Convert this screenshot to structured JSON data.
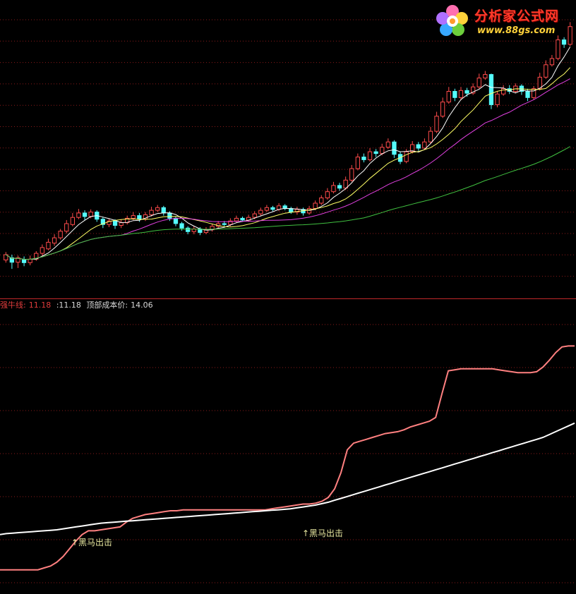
{
  "logo": {
    "title": "分析家公式网",
    "url": "www.88gs.com"
  },
  "header": {
    "indicator_label": "强牛线:",
    "indicator_value": "11.18",
    "second_value": ":11.18",
    "top_cost_label": "顶部成本价:",
    "top_cost_value": "14.06"
  },
  "signals": [
    {
      "label": "↑黑马出击"
    },
    {
      "label": "↑黑马出击"
    }
  ],
  "colors": {
    "up": "#ff4b4b",
    "down": "#54fcfc",
    "ma_short": "#ffffff",
    "ma_mid": "#ffff66",
    "ma_long": "#e040e0",
    "ma_longest": "#40c040",
    "cost_line": "#ff8080",
    "base_line": "#ffffff",
    "grid": "#8a1a1a"
  },
  "chart_data": [
    {
      "type": "candlestick",
      "title": "",
      "ylim": [
        9.4,
        15.6
      ],
      "candles": [
        [
          9.9,
          10.02,
          10.08,
          9.84
        ],
        [
          9.95,
          9.85,
          10.02,
          9.7
        ],
        [
          9.85,
          9.95,
          10.0,
          9.72
        ],
        [
          9.9,
          9.84,
          9.98,
          9.76
        ],
        [
          9.84,
          9.92,
          10.0,
          9.78
        ],
        [
          9.92,
          10.05,
          10.1,
          9.88
        ],
        [
          10.05,
          10.18,
          10.25,
          10.0
        ],
        [
          10.15,
          10.3,
          10.38,
          10.12
        ],
        [
          10.28,
          10.4,
          10.48,
          10.22
        ],
        [
          10.4,
          10.55,
          10.6,
          10.36
        ],
        [
          10.55,
          10.72,
          10.8,
          10.5
        ],
        [
          10.7,
          10.86,
          10.96,
          10.66
        ],
        [
          10.86,
          10.96,
          11.05,
          10.82
        ],
        [
          10.96,
          10.88,
          11.02,
          10.8
        ],
        [
          10.88,
          10.98,
          11.04,
          10.84
        ],
        [
          10.98,
          10.82,
          11.02,
          10.76
        ],
        [
          10.82,
          10.7,
          10.86,
          10.62
        ],
        [
          10.7,
          10.78,
          10.84,
          10.64
        ],
        [
          10.78,
          10.68,
          10.82,
          10.6
        ],
        [
          10.68,
          10.74,
          10.82,
          10.62
        ],
        [
          10.74,
          10.84,
          10.9,
          10.7
        ],
        [
          10.84,
          10.9,
          10.98,
          10.8
        ],
        [
          10.9,
          10.82,
          10.96,
          10.76
        ],
        [
          10.82,
          10.92,
          10.98,
          10.78
        ],
        [
          10.92,
          11.02,
          11.1,
          10.88
        ],
        [
          11.02,
          11.08,
          11.14,
          10.98
        ],
        [
          11.08,
          10.96,
          11.12,
          10.9
        ],
        [
          10.96,
          10.84,
          11.0,
          10.78
        ],
        [
          10.84,
          10.72,
          10.88,
          10.66
        ],
        [
          10.72,
          10.62,
          10.76,
          10.56
        ],
        [
          10.62,
          10.54,
          10.66,
          10.48
        ],
        [
          10.54,
          10.6,
          10.66,
          10.48
        ],
        [
          10.6,
          10.52,
          10.64,
          10.46
        ],
        [
          10.52,
          10.58,
          10.64,
          10.48
        ],
        [
          10.58,
          10.66,
          10.72,
          10.54
        ],
        [
          10.66,
          10.72,
          10.78,
          10.62
        ],
        [
          10.72,
          10.7,
          10.78,
          10.66
        ],
        [
          10.7,
          10.78,
          10.84,
          10.66
        ],
        [
          10.78,
          10.84,
          10.9,
          10.74
        ],
        [
          10.84,
          10.8,
          10.88,
          10.76
        ],
        [
          10.8,
          10.86,
          10.92,
          10.76
        ],
        [
          10.86,
          10.94,
          11.0,
          10.82
        ],
        [
          10.94,
          11.02,
          11.08,
          10.9
        ],
        [
          11.02,
          11.08,
          11.14,
          10.98
        ],
        [
          11.08,
          11.04,
          11.12,
          11.0
        ],
        [
          11.04,
          11.12,
          11.18,
          11.0
        ],
        [
          11.12,
          11.06,
          11.16,
          11.02
        ],
        [
          11.06,
          10.98,
          11.1,
          10.94
        ],
        [
          10.98,
          11.04,
          11.1,
          10.92
        ],
        [
          11.04,
          10.96,
          11.08,
          10.9
        ],
        [
          10.96,
          11.06,
          11.12,
          10.92
        ],
        [
          11.06,
          11.18,
          11.24,
          11.02
        ],
        [
          11.18,
          11.3,
          11.36,
          11.14
        ],
        [
          11.3,
          11.44,
          11.52,
          11.26
        ],
        [
          11.44,
          11.58,
          11.66,
          11.4
        ],
        [
          11.58,
          11.52,
          11.64,
          11.46
        ],
        [
          11.52,
          11.7,
          11.78,
          11.48
        ],
        [
          11.7,
          11.96,
          12.04,
          11.66
        ],
        [
          11.96,
          12.22,
          12.3,
          11.92
        ],
        [
          12.22,
          12.16,
          12.3,
          12.1
        ],
        [
          12.16,
          12.34,
          12.42,
          12.12
        ],
        [
          12.34,
          12.3,
          12.4,
          12.22
        ],
        [
          12.3,
          12.44,
          12.52,
          12.26
        ],
        [
          12.44,
          12.56,
          12.64,
          12.4
        ],
        [
          12.56,
          12.28,
          12.6,
          12.2
        ],
        [
          12.28,
          12.12,
          12.34,
          12.06
        ],
        [
          12.12,
          12.34,
          12.4,
          12.08
        ],
        [
          12.34,
          12.5,
          12.58,
          12.3
        ],
        [
          12.5,
          12.42,
          12.56,
          12.36
        ],
        [
          12.42,
          12.56,
          12.64,
          12.38
        ],
        [
          12.56,
          12.8,
          12.9,
          12.52
        ],
        [
          12.8,
          13.14,
          13.24,
          12.76
        ],
        [
          13.14,
          13.46,
          13.56,
          13.1
        ],
        [
          13.46,
          13.7,
          13.8,
          13.42
        ],
        [
          13.7,
          13.56,
          13.76,
          13.48
        ],
        [
          13.56,
          13.72,
          13.8,
          13.5
        ],
        [
          13.72,
          13.66,
          13.78,
          13.58
        ],
        [
          13.66,
          13.8,
          13.88,
          13.62
        ],
        [
          13.8,
          14.0,
          14.1,
          13.76
        ],
        [
          14.0,
          14.08,
          14.16,
          13.96
        ],
        [
          14.08,
          13.4,
          14.1,
          13.3
        ],
        [
          13.4,
          13.64,
          13.7,
          13.34
        ],
        [
          13.64,
          13.76,
          13.84,
          13.6
        ],
        [
          13.76,
          13.7,
          13.84,
          13.64
        ],
        [
          13.7,
          13.82,
          13.88,
          13.66
        ],
        [
          13.82,
          13.7,
          13.86,
          13.62
        ],
        [
          13.7,
          13.56,
          13.76,
          13.48
        ],
        [
          13.56,
          13.76,
          13.82,
          13.52
        ],
        [
          13.76,
          14.02,
          14.12,
          13.72
        ],
        [
          14.02,
          14.3,
          14.4,
          13.98
        ],
        [
          14.3,
          14.44,
          14.52,
          14.26
        ],
        [
          14.44,
          14.86,
          14.96,
          14.4
        ],
        [
          14.86,
          14.76,
          14.92,
          14.68
        ],
        [
          14.76,
          15.16,
          15.26,
          14.72
        ]
      ],
      "series": [
        {
          "name": "",
          "type": "ma",
          "period": 5
        },
        {
          "name": "",
          "type": "ma",
          "period": 10
        },
        {
          "name": "",
          "type": "ma",
          "period": 20
        },
        {
          "name": "",
          "type": "ma",
          "period": 60
        }
      ],
      "grid": true
    },
    {
      "type": "line",
      "title": "",
      "ylim": [
        9.0,
        14.6
      ],
      "series": [
        {
          "name": "强牛线",
          "values": [
            9.36,
            9.36,
            9.36,
            9.36,
            9.36,
            9.36,
            9.36,
            9.4,
            9.44,
            9.52,
            9.64,
            9.8,
            9.96,
            10.1,
            10.18,
            10.18,
            10.2,
            10.22,
            10.24,
            10.26,
            10.36,
            10.44,
            10.48,
            10.52,
            10.54,
            10.56,
            10.58,
            10.6,
            10.6,
            10.62,
            10.62,
            10.62,
            10.62,
            10.62,
            10.62,
            10.62,
            10.62,
            10.62,
            10.62,
            10.62,
            10.62,
            10.62,
            10.62,
            10.64,
            10.66,
            10.68,
            10.7,
            10.72,
            10.74,
            10.74,
            10.76,
            10.8,
            10.88,
            11.06,
            11.4,
            11.88,
            12.02,
            12.06,
            12.1,
            12.14,
            12.18,
            12.22,
            12.24,
            12.26,
            12.3,
            12.36,
            12.4,
            12.44,
            12.48,
            12.56,
            13.06,
            13.54,
            13.56,
            13.58,
            13.58,
            13.58,
            13.58,
            13.58,
            13.58,
            13.56,
            13.54,
            13.52,
            13.5,
            13.5,
            13.5,
            13.52,
            13.62,
            13.76,
            13.92,
            14.04,
            14.06,
            14.06
          ]
        },
        {
          "name": "",
          "values": [
            10.1,
            10.12,
            10.13,
            10.14,
            10.15,
            10.16,
            10.17,
            10.18,
            10.19,
            10.2,
            10.22,
            10.24,
            10.26,
            10.28,
            10.3,
            10.32,
            10.34,
            10.35,
            10.36,
            10.37,
            10.38,
            10.39,
            10.4,
            10.41,
            10.42,
            10.43,
            10.44,
            10.45,
            10.46,
            10.47,
            10.48,
            10.49,
            10.5,
            10.51,
            10.52,
            10.53,
            10.54,
            10.55,
            10.56,
            10.57,
            10.58,
            10.59,
            10.6,
            10.61,
            10.62,
            10.63,
            10.64,
            10.66,
            10.68,
            10.7,
            10.72,
            10.75,
            10.78,
            10.82,
            10.86,
            10.9,
            10.94,
            10.98,
            11.02,
            11.06,
            11.1,
            11.14,
            11.18,
            11.22,
            11.26,
            11.3,
            11.34,
            11.38,
            11.42,
            11.46,
            11.5,
            11.54,
            11.58,
            11.62,
            11.66,
            11.7,
            11.74,
            11.78,
            11.82,
            11.86,
            11.9,
            11.94,
            11.98,
            12.02,
            12.06,
            12.1,
            12.14,
            12.2,
            12.26,
            12.32,
            12.38,
            12.44
          ]
        }
      ]
    }
  ]
}
